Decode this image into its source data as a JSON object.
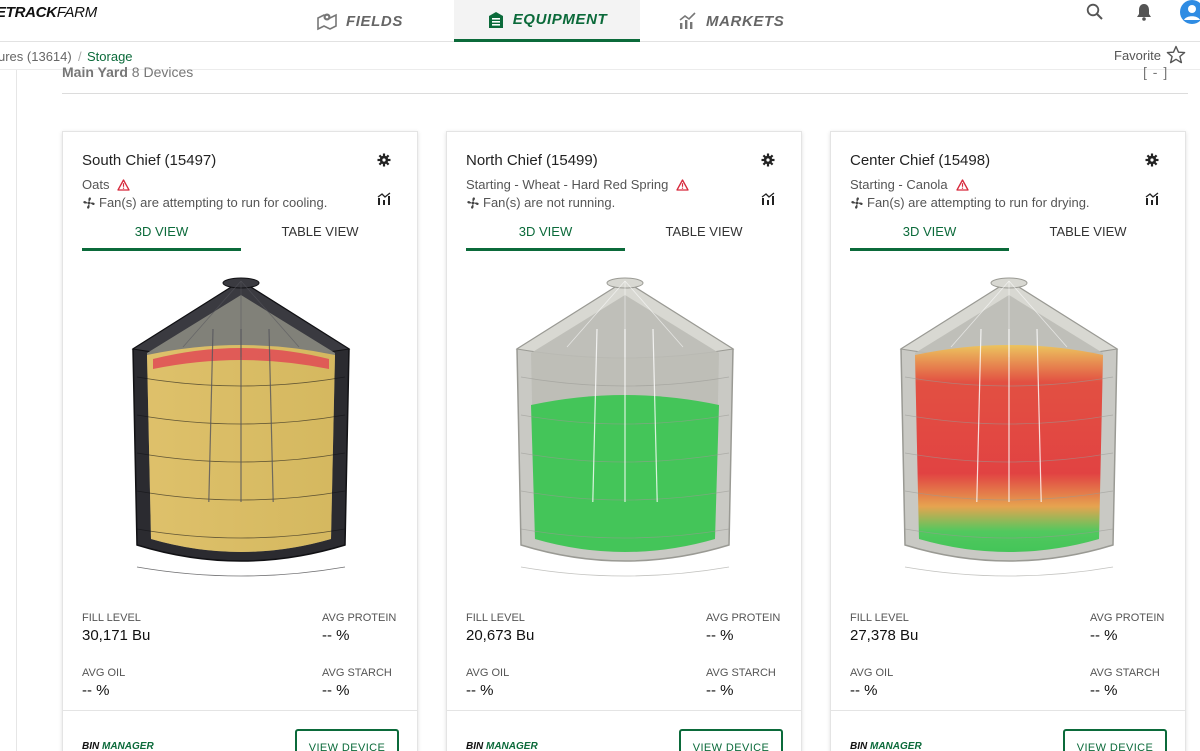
{
  "app": {
    "brand_bold": "ETRACK",
    "brand_light": "FARM"
  },
  "nav": {
    "tabs": [
      {
        "label": "FIELDS",
        "icon": "field-map-icon",
        "active": false
      },
      {
        "label": "EQUIPMENT",
        "icon": "equipment-icon",
        "active": true
      },
      {
        "label": "MARKETS",
        "icon": "markets-chart-icon",
        "active": false
      }
    ],
    "accent": "#0b6a3a"
  },
  "breadcrumb": {
    "previous": "ures (13614)",
    "separator": "/",
    "current": "Storage"
  },
  "favorite": {
    "label": "Favorite"
  },
  "section": {
    "name": "Main Yard",
    "count": "8 Devices",
    "toggle": "[ - ]"
  },
  "tab_labels": {
    "view3d": "3D VIEW",
    "table": "TABLE VIEW"
  },
  "stat_labels": {
    "fill": "FILL LEVEL",
    "protein": "AVG PROTEIN",
    "oil": "AVG OIL",
    "starch": "AVG STARCH"
  },
  "footer": {
    "logo_a": "BIN ",
    "logo_b": "MANAGER",
    "button": "VIEW DEVICE"
  },
  "cards": [
    {
      "title": "South Chief (15497)",
      "status": "Oats",
      "fan": "Fan(s) are attempting to run for cooling.",
      "fill_level": "30,171 Bu",
      "avg_protein": "-- %",
      "avg_oil": "-- %",
      "avg_starch": "-- %",
      "bin_color": "dark",
      "grain_color": "#e8c766"
    },
    {
      "title": "North Chief (15499)",
      "status": "Starting - Wheat - Hard Red Spring",
      "fan": "Fan(s) are not running.",
      "fill_level": "20,673 Bu",
      "avg_protein": "-- %",
      "avg_oil": "-- %",
      "avg_starch": "-- %",
      "bin_color": "light",
      "grain_color": "#3dc553"
    },
    {
      "title": "Center Chief (15498)",
      "status": "Starting - Canola",
      "fan": "Fan(s) are attempting to run for drying.",
      "fill_level": "27,378 Bu",
      "avg_protein": "-- %",
      "avg_oil": "-- %",
      "avg_starch": "-- %",
      "bin_color": "light",
      "grain_color": "#e33c3c"
    }
  ]
}
